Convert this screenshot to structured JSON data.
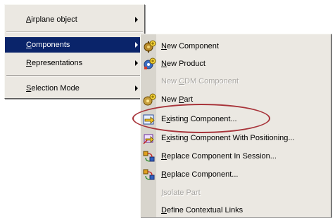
{
  "context_menu": {
    "items": [
      {
        "label": "Airplane object",
        "mnemonic_index": 0
      },
      {
        "label": "Components",
        "mnemonic_index": 0
      },
      {
        "label": "Representations",
        "mnemonic_index": 0
      },
      {
        "label": "Selection Mode",
        "mnemonic_index": 0
      }
    ]
  },
  "submenu": {
    "items": [
      {
        "label": "New Component",
        "icon": "new-component-icon",
        "mnemonic_index": 0
      },
      {
        "label": "New Product",
        "icon": "new-product-icon",
        "mnemonic_index": 0
      },
      {
        "label": "New CDM Component",
        "icon": "",
        "mnemonic_index": 4
      },
      {
        "label": "New Part",
        "icon": "new-part-icon",
        "mnemonic_index": 4
      },
      {
        "label": "Existing Component...",
        "icon": "existing-component-icon",
        "mnemonic_index": 1
      },
      {
        "label": "Existing Component With Positioning...",
        "icon": "existing-component-positioning-icon",
        "mnemonic_index": 1
      },
      {
        "label": "Replace Component In Session...",
        "icon": "replace-component-session-icon",
        "mnemonic_index": 0
      },
      {
        "label": "Replace Component...",
        "icon": "replace-component-icon",
        "mnemonic_index": 0
      },
      {
        "label": "Isolate Part",
        "icon": "",
        "mnemonic_index": 0
      },
      {
        "label": "Define Contextual Links",
        "icon": "",
        "mnemonic_index": 0
      }
    ]
  },
  "colors": {
    "menu_background": "#ebe8e2",
    "selection_highlight": "#0a246a",
    "highlight_ellipse": "#a8343a",
    "disabled_text": "#a8a6a2"
  }
}
